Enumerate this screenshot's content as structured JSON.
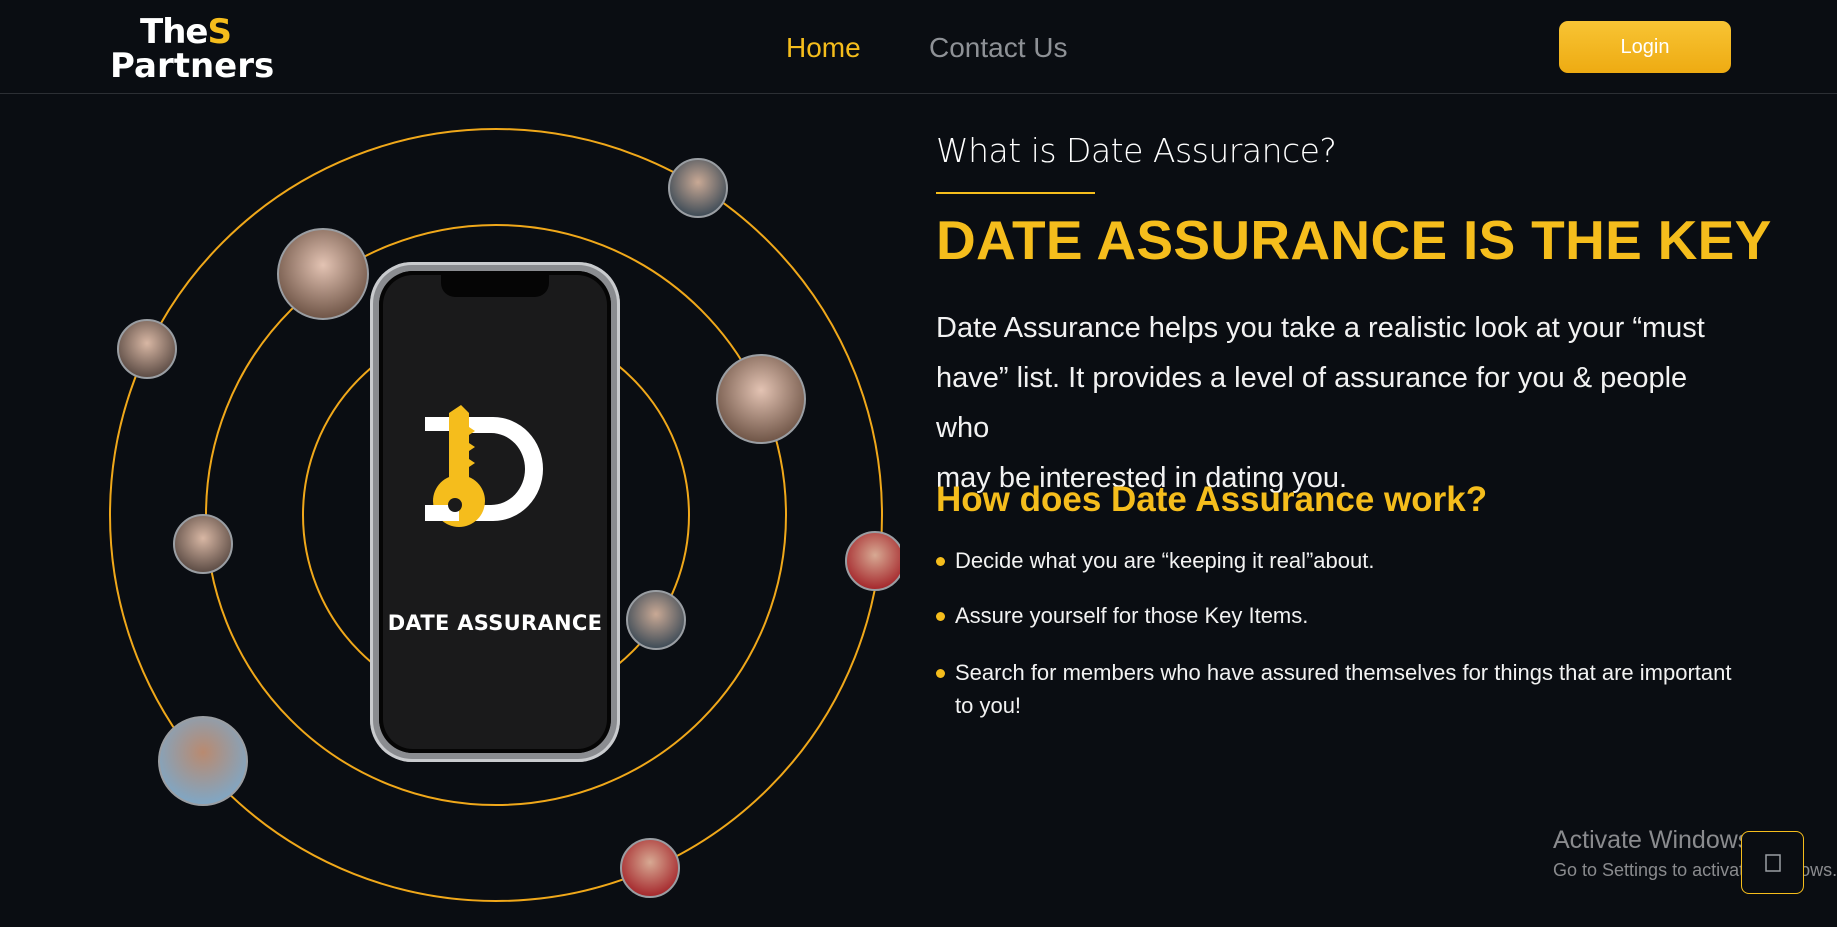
{
  "header": {
    "logo_line1": "The",
    "logo_s": "S",
    "logo_line2": "Partners",
    "nav": {
      "home": "Home",
      "contact": "Contact Us"
    },
    "login_label": "Login"
  },
  "illustration": {
    "app_name": "DATE ASSURANCE",
    "avatar_icons": [
      "man-suit-avatar",
      "woman-long-hair-avatar",
      "woman-smiling-avatar",
      "woman-pose-avatar",
      "woman-hat-avatar",
      "woman-red-dress-avatar",
      "man-blue-shirt-avatar",
      "woman-curly-hair-avatar",
      "woman-red-top-avatar"
    ]
  },
  "main": {
    "question_title": "What is Date Assurance?",
    "headline": "DATE ASSURANCE IS THE KEY",
    "intro_lines": [
      "Date Assurance helps you take a realistic look at your “must",
      "have” list. It provides a level of assurance for you & people who",
      "may be interested in dating you."
    ],
    "how_title": "How does Date Assurance work?",
    "steps": [
      "Decide what you are “keeping it real”about.",
      "Assure yourself for those Key Items.",
      "Search for members who have assured themselves for things that are important to you!"
    ]
  },
  "watermark": {
    "line1": "Activate Windows",
    "line2": "Go to Settings to activate Windows."
  },
  "colors": {
    "background": "#0a0d12",
    "accent": "#f5bd1c",
    "orbit": "#f0a81a",
    "nav_inactive": "#8e9196"
  }
}
